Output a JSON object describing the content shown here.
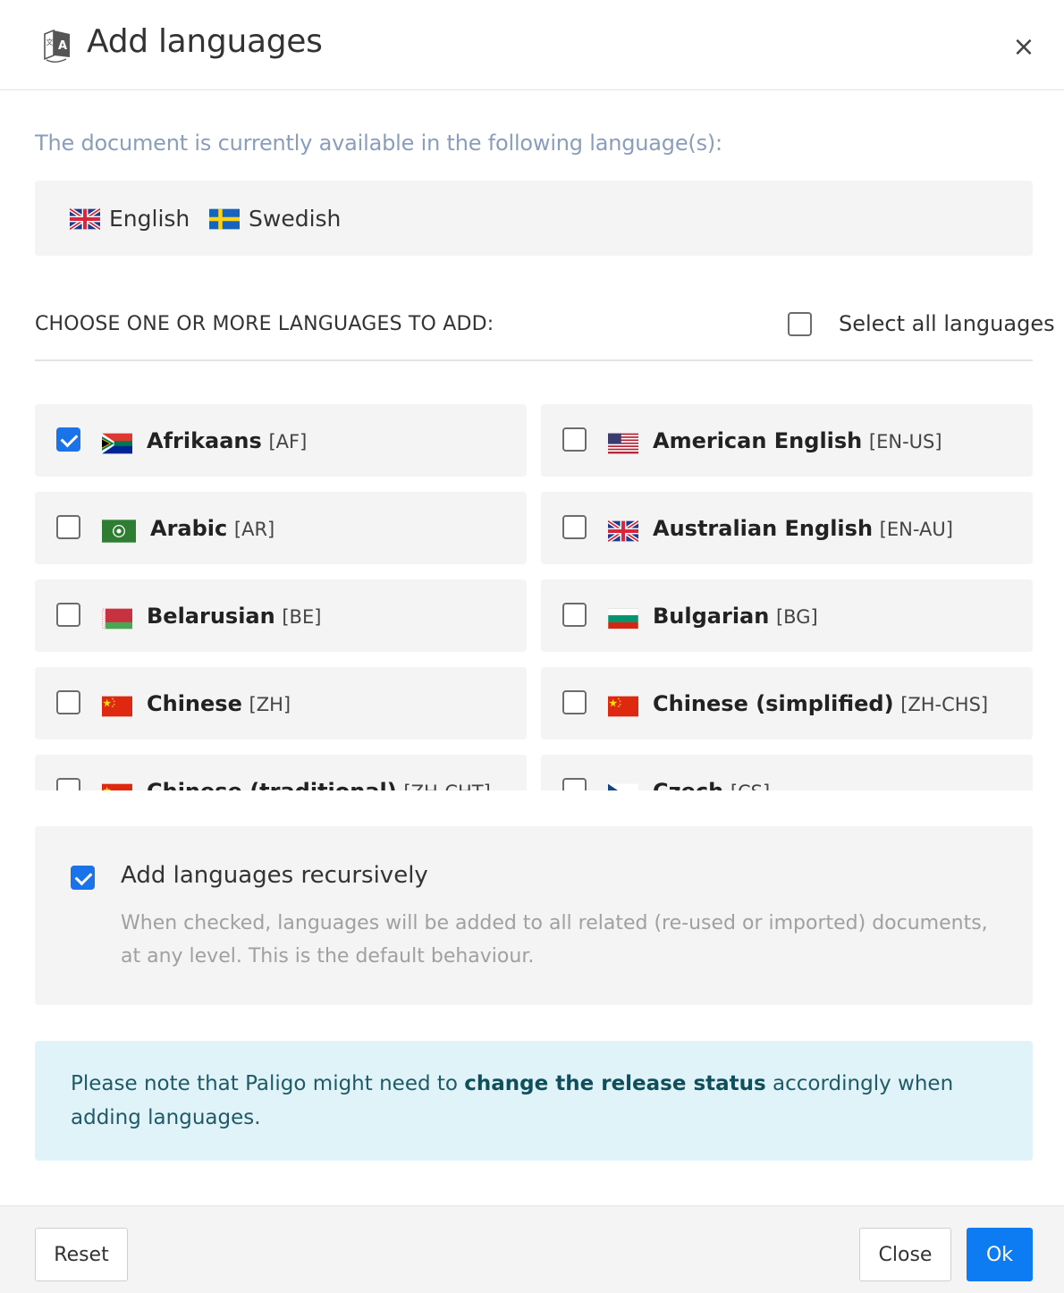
{
  "header": {
    "title": "Add languages",
    "close_symbol": "×",
    "icon": "translate-icon"
  },
  "intro": "The document is currently available in the following language(s):",
  "current_languages": [
    {
      "name": "English",
      "flag": "uk-flag-icon"
    },
    {
      "name": "Swedish",
      "flag": "sweden-flag-icon"
    }
  ],
  "choose_label": "CHOOSE ONE OR MORE LANGUAGES TO ADD:",
  "select_all_label": "Select all languages",
  "select_all_checked": false,
  "languages": [
    {
      "name": "Afrikaans",
      "code": "[AF]",
      "checked": true,
      "flag": "south-africa-flag-icon"
    },
    {
      "name": "American English",
      "code": "[EN-US]",
      "checked": false,
      "flag": "us-flag-icon"
    },
    {
      "name": "Arabic",
      "code": "[AR]",
      "checked": false,
      "flag": "arab-league-flag-icon"
    },
    {
      "name": "Australian English",
      "code": "[EN-AU]",
      "checked": false,
      "flag": "uk-flag-icon"
    },
    {
      "name": "Belarusian",
      "code": "[BE]",
      "checked": false,
      "flag": "belarus-flag-icon"
    },
    {
      "name": "Bulgarian",
      "code": "[BG]",
      "checked": false,
      "flag": "bulgaria-flag-icon"
    },
    {
      "name": "Chinese",
      "code": "[ZH]",
      "checked": false,
      "flag": "china-flag-icon"
    },
    {
      "name": "Chinese (simplified)",
      "code": "[ZH-CHS]",
      "checked": false,
      "flag": "china-flag-icon"
    },
    {
      "name": "Chinese (traditional)",
      "code": "[ZH-CHT]",
      "checked": false,
      "flag": "china-flag-icon"
    },
    {
      "name": "Czech",
      "code": "[CS]",
      "checked": false,
      "flag": "czech-flag-icon"
    }
  ],
  "recursive": {
    "checked": true,
    "title": "Add languages recursively",
    "description": "When checked, languages will be added to all related (re-used or imported) documents, at any level. This is the default behaviour."
  },
  "note": {
    "before": "Please note that Paligo might need to ",
    "bold": "change the release status",
    "after": " accordingly when adding languages."
  },
  "footer": {
    "reset_label": "Reset",
    "close_label": "Close",
    "ok_label": "Ok"
  },
  "colors": {
    "primary": "#0d7bf2",
    "intro_text": "#8a9dbd",
    "panel_bg": "#f4f4f4",
    "note_bg": "#e0f3f9"
  }
}
